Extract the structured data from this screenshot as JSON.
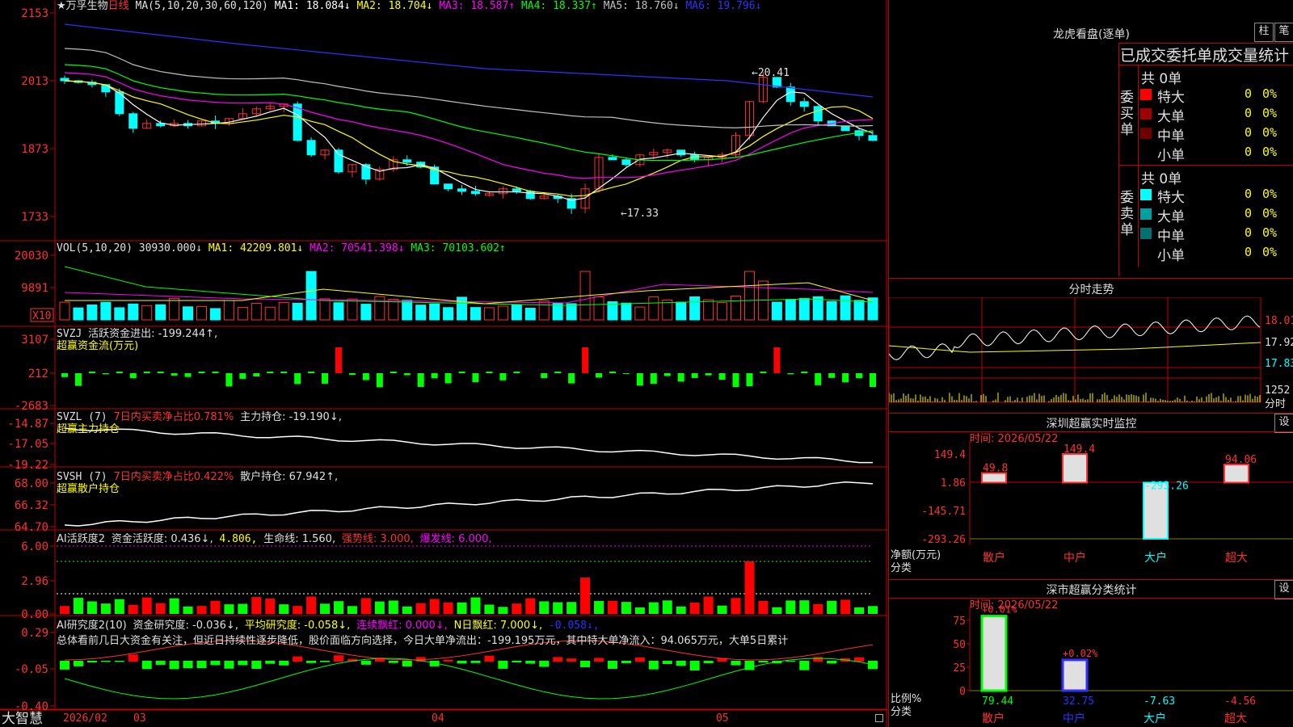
{
  "stock": {
    "name": "★万孚生物",
    "period": "日线",
    "ma_header": "MA(5,10,20,30,60,120)",
    "ma_values": [
      {
        "label": "MA1: 18.084↓",
        "color": "#ffffff"
      },
      {
        "label": "MA2: 18.704↓",
        "color": "#ffff00"
      },
      {
        "label": "MA3: 18.587↑",
        "color": "#ff00ff"
      },
      {
        "label": "MA4: 18.337↑",
        "color": "#00ff00"
      },
      {
        "label": "MA5: 18.760↓",
        "color": "#c0c0c0"
      },
      {
        "label": "MA6: 19.796↓",
        "color": "#3030ff"
      }
    ],
    "y_ticks": [
      "2153",
      "2013",
      "1873",
      "1733"
    ],
    "high_label": "20.41",
    "low_label": "17.33"
  },
  "vol": {
    "header": "VOL(5,10,20)",
    "value": "30930.000↓",
    "ma": [
      {
        "label": "MA1: 42209.801↓",
        "color": "#ffff00"
      },
      {
        "label": "MA2: 70541.398↓",
        "color": "#ff00ff"
      },
      {
        "label": "MA3: 70103.602↑",
        "color": "#00ff00"
      }
    ],
    "y_ticks": [
      "20030",
      "9891"
    ],
    "unit": "X10"
  },
  "svzj": {
    "header": "SVZJ",
    "label": "活跃资金进出: -199.244↑,",
    "sub": "超赢资金流(万元)",
    "y_ticks": [
      "3107",
      "212",
      "-2683"
    ]
  },
  "svzl": {
    "header": "SVZL (7)",
    "ratio": "7日内买卖净占比0.781%",
    "label": "主力持仓: -19.190↓,",
    "sub": "超赢主力持仓",
    "y_ticks": [
      "-14.87",
      "-17.05",
      "-19.22"
    ]
  },
  "svsh": {
    "header": "SVSH (7)",
    "ratio": "7日内买卖净占比0.422%",
    "label": "散户持仓: 67.942↑,",
    "sub": "超赢散户持仓",
    "y_ticks": [
      "68.00",
      "66.32",
      "64.70"
    ]
  },
  "ai1": {
    "header": "AI活跃度2",
    "a": "资金活跃度: 0.436↓,",
    "b": "4.806,",
    "c": "生命线: 1.560,",
    "d": "强势线: 3.000,",
    "e": "爆发线: 6.000,",
    "y_ticks": [
      "6.00",
      "2.96",
      "0.00"
    ]
  },
  "ai2": {
    "header": "AI研究度2(10)",
    "a": "资金研究度: -0.036↓,",
    "b": "平均研究度: -0.058↓,",
    "c": "连续飘红: 0.000↓,",
    "d": "N日飘红: 7.000↓,",
    "e": "-0.058↓,",
    "summary": "总体看前几日大资金有关注，但近日持续性逐步降低，股价面临方向选择，今日大单净流出：-199.195万元，其中特大单净流入：94.065万元，大单5日累计",
    "y_ticks": [
      "0.29",
      "-0.05",
      "-0.40"
    ]
  },
  "bottom": {
    "brand": "大智慧",
    "dates": [
      "2026/02",
      "03",
      "04",
      "05"
    ]
  },
  "right": {
    "lhb_title": "龙虎看盘(逐单)",
    "btn_bar": "柱",
    "btn_pen": "笔",
    "tabs": "已成交委托单成交量统计",
    "buy": {
      "side": "委买单",
      "total": "共 0单",
      "rows": [
        {
          "label": "特大",
          "n": "0",
          "p": "0%",
          "color": "#ff0000"
        },
        {
          "label": "大单",
          "n": "0",
          "p": "0%",
          "color": "#a00000"
        },
        {
          "label": "中单",
          "n": "0",
          "p": "0%",
          "color": "#700000"
        },
        {
          "label": "小单",
          "n": "0",
          "p": "0%",
          "color": "#000000"
        }
      ]
    },
    "sell": {
      "side": "委卖单",
      "total": "共 0单",
      "rows": [
        {
          "label": "特大",
          "n": "0",
          "p": "0%",
          "color": "#00ffff"
        },
        {
          "label": "大单",
          "n": "0",
          "p": "0%",
          "color": "#00a0a0"
        },
        {
          "label": "中单",
          "n": "0",
          "p": "0%",
          "color": "#007070"
        },
        {
          "label": "小单",
          "n": "0",
          "p": "0%",
          "color": "#000000"
        }
      ]
    },
    "fenshi_title": "分时走势",
    "fenshi_prices": [
      "18.01",
      "17.92",
      "17.83"
    ],
    "fenshi_vol": "1252",
    "fenshi_tag": "分时",
    "monitor_title": "深圳超赢实时监控",
    "monitor_btn": "设",
    "monitor_time": "时间: 2026/05/22",
    "monitor_y": [
      "149.4",
      "1.86",
      "-145.71",
      "-293.26"
    ],
    "monitor_ylabel": "净额(万元)",
    "monitor_xlabel": "分类",
    "monitor_bars": [
      {
        "cat": "散户",
        "value": 49.8,
        "label": "49.8",
        "cat_color": "#ff3030"
      },
      {
        "cat": "中户",
        "value": 149.4,
        "label": "149.4",
        "cat_color": "#ff3030"
      },
      {
        "cat": "大户",
        "value": -293.26,
        "label": "-293.26",
        "cat_color": "#00ffff"
      },
      {
        "cat": "超大",
        "value": 94.06,
        "label": "94.06",
        "cat_color": "#ff3030"
      }
    ],
    "class_title": "深市超赢分类统计",
    "class_btn": "设",
    "class_time": "时间: 2026/05/22",
    "class_y": [
      "75",
      "50",
      "25",
      "0"
    ],
    "class_ylabel": "比例%",
    "class_xlabel": "分类",
    "class_bars": [
      {
        "cat": "散户",
        "value": 79.44,
        "bottom": "79.44",
        "top": "+0.01%",
        "cat_color": "#ff3030",
        "val_color": "#00ff00"
      },
      {
        "cat": "中户",
        "value": 32.75,
        "bottom": "32.75",
        "top": "+0.02%",
        "cat_color": "#3030ff",
        "val_color": "#3030ff"
      },
      {
        "cat": "大户",
        "value": -7.63,
        "bottom": "-7.63",
        "top": "",
        "cat_color": "#00ffff",
        "val_color": "#00ffff"
      },
      {
        "cat": "超大",
        "value": -4.56,
        "bottom": "-4.56",
        "top": "",
        "cat_color": "#ff3030",
        "val_color": "#ff3030"
      }
    ]
  }
}
